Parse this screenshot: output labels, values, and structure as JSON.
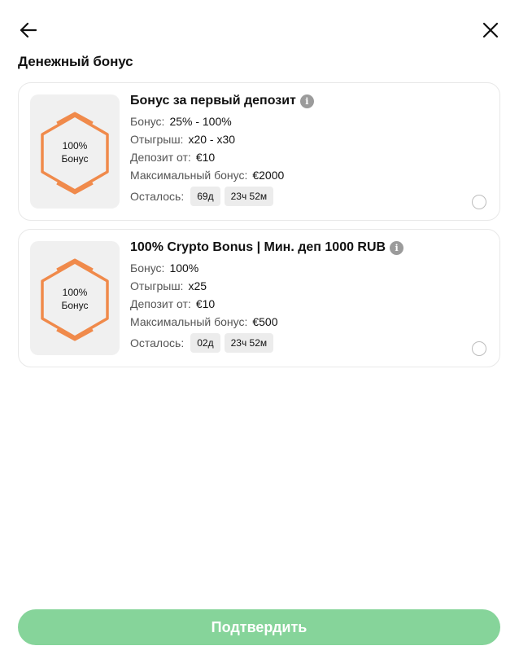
{
  "header": {
    "back_icon": "arrow-left-icon",
    "close_icon": "close-icon"
  },
  "section_title": "Денежный бонус",
  "colors": {
    "badge_accent": "#f08a4b",
    "confirm_button": "#86d49a",
    "info_icon": "#9b9b9b"
  },
  "bonuses": [
    {
      "badge_percent": "100%",
      "badge_word": "Бонус",
      "title": "Бонус за первый депозит",
      "info_icon": "info-icon",
      "bonus_label": "Бонус:",
      "bonus_value": "25% - 100%",
      "wager_label": "Отыгрыш:",
      "wager_value": "x20 - x30",
      "deposit_label": "Депозит от:",
      "deposit_value": "€10",
      "max_label": "Максимальный бонус:",
      "max_value": "€2000",
      "remaining_label": "Осталось:",
      "remaining_days": "69д",
      "remaining_time": "23ч 52м",
      "selected": false
    },
    {
      "badge_percent": "100%",
      "badge_word": "Бонус",
      "title": "100% Crypto Bonus | Мин. деп 1000 RUB",
      "info_icon": "info-icon",
      "bonus_label": "Бонус:",
      "bonus_value": "100%",
      "wager_label": "Отыгрыш:",
      "wager_value": "x25",
      "deposit_label": "Депозит от:",
      "deposit_value": "€10",
      "max_label": "Максимальный бонус:",
      "max_value": "€500",
      "remaining_label": "Осталось:",
      "remaining_days": "02д",
      "remaining_time": "23ч 52м",
      "selected": false
    }
  ],
  "confirm_label": "Подтвердить"
}
